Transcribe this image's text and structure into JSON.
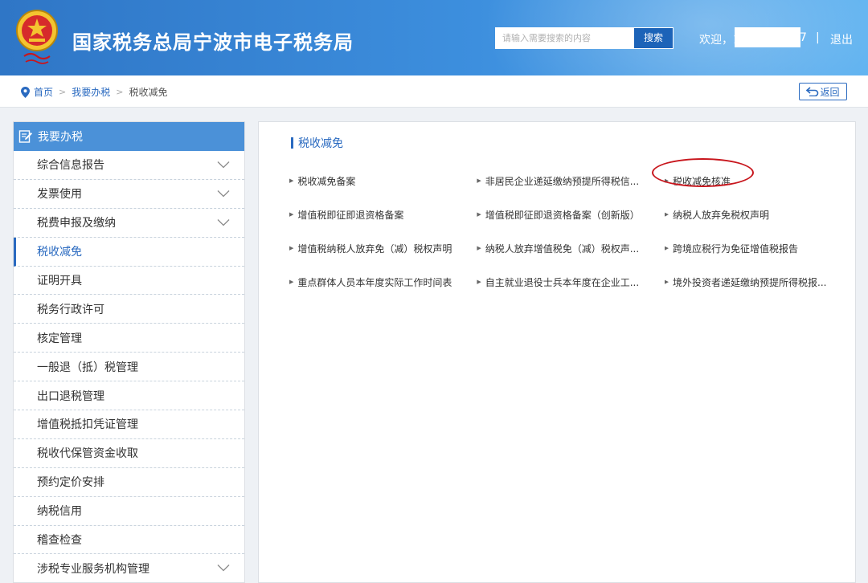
{
  "header": {
    "title": "国家税务总局宁波市电子税务局",
    "search_placeholder": "请输入需要搜索的内容",
    "search_button": "搜索",
    "welcome": "欢迎，1",
    "user_tail": "7",
    "separator": "|",
    "logout": "退出"
  },
  "breadcrumb": {
    "home": "首页",
    "level1": "我要办税",
    "current": "税收减免",
    "arrow": ">"
  },
  "back_button": "返回",
  "sidebar": {
    "title": "我要办税",
    "items": [
      {
        "label": "综合信息报告",
        "expandable": true
      },
      {
        "label": "发票使用",
        "expandable": true
      },
      {
        "label": "税费申报及缴纳",
        "expandable": true
      },
      {
        "label": "税收减免",
        "expandable": false,
        "active": true
      },
      {
        "label": "证明开具",
        "expandable": false
      },
      {
        "label": "税务行政许可",
        "expandable": false
      },
      {
        "label": "核定管理",
        "expandable": false
      },
      {
        "label": "一般退（抵）税管理",
        "expandable": false
      },
      {
        "label": "出口退税管理",
        "expandable": false
      },
      {
        "label": "增值税抵扣凭证管理",
        "expandable": false
      },
      {
        "label": "税收代保管资金收取",
        "expandable": false
      },
      {
        "label": "预约定价安排",
        "expandable": false
      },
      {
        "label": "纳税信用",
        "expandable": false
      },
      {
        "label": "稽查检查",
        "expandable": false
      },
      {
        "label": "涉税专业服务机构管理",
        "expandable": true
      }
    ]
  },
  "content": {
    "section_title": "税收减免",
    "rows": [
      [
        "税收减免备案",
        "非居民企业递延缴纳预提所得税信...",
        "税收减免核准"
      ],
      [
        "增值税即征即退资格备案",
        "增值税即征即退资格备案（创新版）",
        "纳税人放弃免税权声明"
      ],
      [
        "增值税纳税人放弃免（减）税权声明",
        "纳税人放弃增值税免（减）税权声...",
        "跨境应税行为免征增值税报告"
      ],
      [
        "重点群体人员本年度实际工作时间表",
        "自主就业退役士兵本年度在企业工...",
        "境外投资者递延缴纳预提所得税报..."
      ]
    ]
  },
  "colors": {
    "header_start": "#2f76c6",
    "header_end": "#5ab0f0",
    "accent": "#2a6ac0",
    "sidebar_header": "#4b91d8",
    "highlight_ellipse": "#c8161d"
  }
}
